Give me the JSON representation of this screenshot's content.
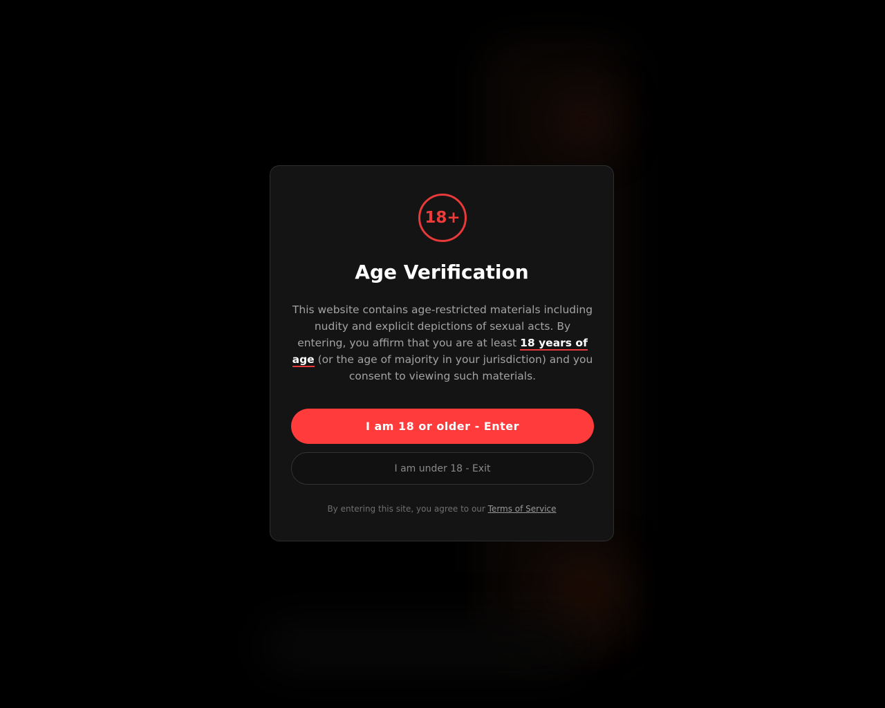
{
  "modal": {
    "badge": "18+",
    "title": "Age Verification",
    "description": {
      "before": "This website contains age-restricted materials including nudity and explicit depictions of sexual acts. By entering, you affirm that you are at least ",
      "emphasis": "18 years of age",
      "after": " (or the age of majority in your jurisdiction) and you consent to viewing such materials."
    },
    "enter_button": "I am 18 or older - Enter",
    "exit_button": "I am under 18 - Exit",
    "footer": {
      "text": "By entering this site, you agree to our ",
      "link": "Terms of Service"
    }
  },
  "colors": {
    "accent": "#ff3b3b",
    "badge_border": "#e83a3a",
    "modal_background": "#141414",
    "page_background": "#000000"
  }
}
